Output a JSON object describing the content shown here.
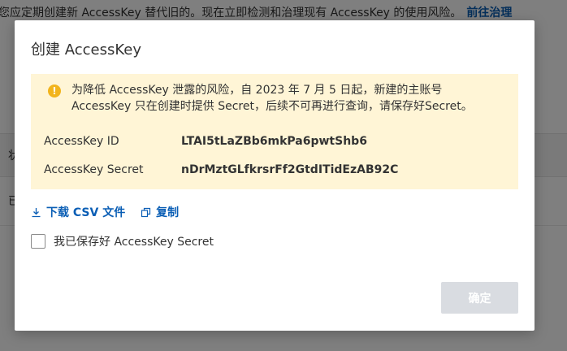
{
  "background": {
    "banner_text": "您应定期创建新 AccessKey 替代旧的。现在立即检测和治理现有 AccessKey 的使用风险。",
    "banner_link": "前往治理",
    "table_header_fragment": "状",
    "table_row_fragment": "已"
  },
  "dialog": {
    "title": "创建 AccessKey",
    "notice": {
      "icon": "warning-icon",
      "line1": "为降低 AccessKey 泄露的风险，自 2023 年 7 月 5 日起，新建的主账号",
      "line2": "AccessKey 只在创建时提供 Secret，后续不可再进行查询，请保存好Secret。"
    },
    "fields": [
      {
        "label": "AccessKey ID",
        "value": "LTAI5tLaZBb6mkPa6pwtShb6"
      },
      {
        "label": "AccessKey Secret",
        "value": "nDrMztGLfkrsrFf2GtdITidEzAB92C"
      }
    ],
    "actions": {
      "download_label": "下载 CSV 文件",
      "copy_label": "复制"
    },
    "confirm_checkbox_label": "我已保存好 AccessKey Secret",
    "ok_label": "确定"
  },
  "colors": {
    "link": "#0a5eb5",
    "notice_bg": "#fff5d6",
    "warning": "#f2b41c",
    "disabled_button": "#d9dce1"
  }
}
